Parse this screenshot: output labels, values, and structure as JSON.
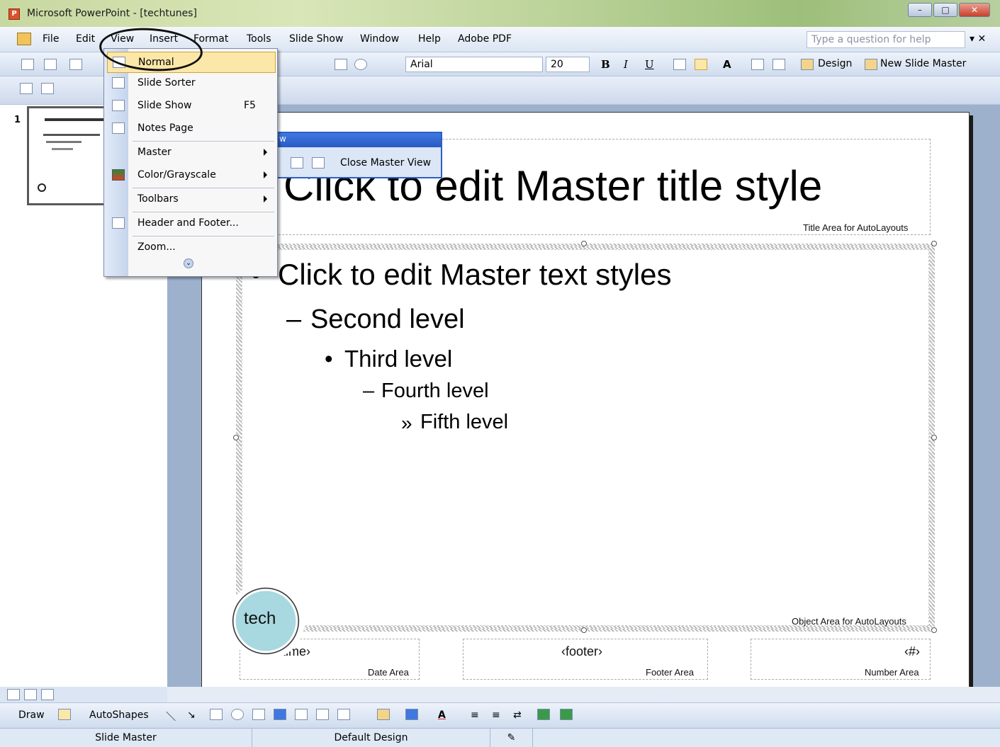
{
  "window": {
    "title": "Microsoft PowerPoint - [techtunes]"
  },
  "menubar": {
    "items": [
      "File",
      "Edit",
      "View",
      "Insert",
      "Format",
      "Tools",
      "Slide Show",
      "Window",
      "Help",
      "Adobe PDF"
    ],
    "help_placeholder": "Type a question for help",
    "close_glyph": "▾ ✕"
  },
  "toolbar": {
    "font_name": "Arial",
    "font_size": "20",
    "design_label": "Design",
    "new_slide_master_label": "New Slide Master"
  },
  "view_menu": {
    "items": [
      {
        "label": "Normal",
        "shortcut": "",
        "submenu": false,
        "highlighted": true
      },
      {
        "label": "Slide Sorter",
        "shortcut": "",
        "submenu": false
      },
      {
        "label": "Slide Show",
        "shortcut": "F5",
        "submenu": false
      },
      {
        "label": "Notes Page",
        "shortcut": "",
        "submenu": false
      },
      {
        "label": "Master",
        "shortcut": "",
        "submenu": true
      },
      {
        "label": "Color/Grayscale",
        "shortcut": "",
        "submenu": true
      },
      {
        "label": "Toolbars",
        "shortcut": "",
        "submenu": true
      },
      {
        "label": "Header and Footer...",
        "shortcut": "",
        "submenu": false
      },
      {
        "label": "Zoom...",
        "shortcut": "",
        "submenu": false
      }
    ]
  },
  "master_view_toolbar": {
    "title_fragment": "w",
    "close_label": "Close Master View"
  },
  "slide_pane": {
    "slide_number": "1"
  },
  "slide": {
    "title": "Click to edit Master title style",
    "title_area_label": "Title Area for AutoLayouts",
    "levels": [
      "Click to edit Master text styles",
      "Second level",
      "Third level",
      "Fourth level",
      "Fifth level"
    ],
    "level_bullets": [
      "•",
      "–",
      "•",
      "–",
      "»"
    ],
    "object_area_label": "Object Area for AutoLayouts",
    "date_placeholder": "‹date/time›",
    "date_area_label": "Date Area",
    "footer_placeholder": "‹footer›",
    "footer_area_label": "Footer Area",
    "number_placeholder": "‹#›",
    "number_area_label": "Number Area",
    "watermark": "tech"
  },
  "drawing_toolbar": {
    "draw_label": "Draw",
    "autoshapes_label": "AutoShapes"
  },
  "statusbar": {
    "view": "Slide Master",
    "design": "Default Design"
  }
}
